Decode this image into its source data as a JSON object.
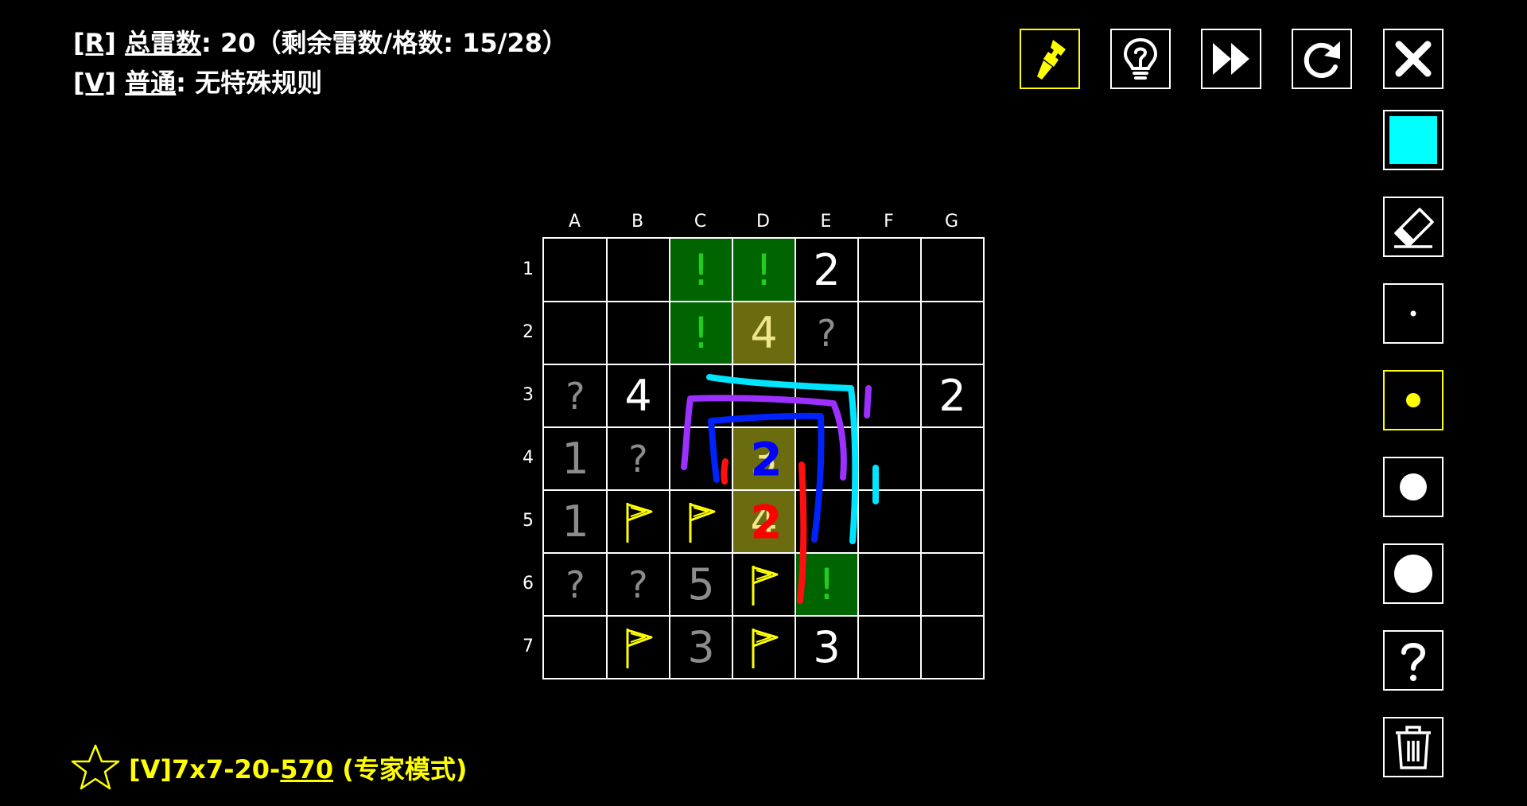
{
  "header": {
    "rule_r_key": "[R]",
    "rule_r_label": "总雷数",
    "rule_r_value": ": 20（剩余雷数/格数: 15/28）",
    "rule_v_key": "[V]",
    "rule_v_label": "普通",
    "rule_v_value": ": 无特殊规则"
  },
  "toolbar": [
    {
      "name": "brush-tool-button",
      "icon": "brush-icon",
      "active": true
    },
    {
      "name": "hint-button",
      "icon": "lightbulb-icon",
      "active": false
    },
    {
      "name": "fast-forward-button",
      "icon": "fast-forward-icon",
      "active": false
    },
    {
      "name": "restart-button",
      "icon": "refresh-icon",
      "active": false
    },
    {
      "name": "close-button",
      "icon": "close-icon",
      "active": false
    }
  ],
  "side_tools": [
    {
      "name": "color-cyan-button",
      "icon": "color-swatch-icon",
      "color": "#00ffff",
      "active": false
    },
    {
      "name": "eraser-button",
      "icon": "eraser-icon",
      "active": false
    },
    {
      "name": "brush-size-tiny-button",
      "icon": "dot-tiny-icon",
      "active": false
    },
    {
      "name": "brush-size-small-button",
      "icon": "dot-small-icon",
      "color": "#ffff00",
      "active": true
    },
    {
      "name": "brush-size-medium-button",
      "icon": "dot-medium-icon",
      "active": false
    },
    {
      "name": "brush-size-large-button",
      "icon": "dot-large-icon",
      "active": false
    },
    {
      "name": "help-button",
      "icon": "question-icon",
      "active": false
    },
    {
      "name": "clear-drawing-button",
      "icon": "trash-icon",
      "active": false
    }
  ],
  "board": {
    "columns": [
      "A",
      "B",
      "C",
      "D",
      "E",
      "F",
      "G"
    ],
    "rows": [
      "1",
      "2",
      "3",
      "4",
      "5",
      "6",
      "7"
    ],
    "cells": [
      [
        {
          "t": ""
        },
        {
          "t": ""
        },
        {
          "t": "!",
          "s": "mine"
        },
        {
          "t": "!",
          "s": "mine"
        },
        {
          "t": "2",
          "s": "num"
        },
        {
          "t": ""
        },
        {
          "t": ""
        }
      ],
      [
        {
          "t": ""
        },
        {
          "t": ""
        },
        {
          "t": "!",
          "s": "mine"
        },
        {
          "t": "4",
          "s": "hl"
        },
        {
          "t": "?",
          "s": "q"
        },
        {
          "t": ""
        },
        {
          "t": ""
        }
      ],
      [
        {
          "t": "?",
          "s": "q"
        },
        {
          "t": "4",
          "s": "num"
        },
        {
          "t": ""
        },
        {
          "t": ""
        },
        {
          "t": ""
        },
        {
          "t": ""
        },
        {
          "t": "2",
          "s": "num"
        }
      ],
      [
        {
          "t": "1",
          "s": "dim"
        },
        {
          "t": "?",
          "s": "q"
        },
        {
          "t": ""
        },
        {
          "t": "3",
          "s": "hl"
        },
        {
          "t": ""
        },
        {
          "t": ""
        },
        {
          "t": ""
        }
      ],
      [
        {
          "t": "1",
          "s": "dim"
        },
        {
          "t": "flag",
          "s": "flag"
        },
        {
          "t": "flag",
          "s": "flag"
        },
        {
          "t": "4",
          "s": "hl"
        },
        {
          "t": ""
        },
        {
          "t": ""
        },
        {
          "t": ""
        }
      ],
      [
        {
          "t": "?",
          "s": "q"
        },
        {
          "t": "?",
          "s": "q"
        },
        {
          "t": "5",
          "s": "dim"
        },
        {
          "t": "flag",
          "s": "flag"
        },
        {
          "t": "!",
          "s": "mine"
        },
        {
          "t": ""
        },
        {
          "t": ""
        }
      ],
      [
        {
          "t": ""
        },
        {
          "t": "flag",
          "s": "flag"
        },
        {
          "t": "3",
          "s": "dim"
        },
        {
          "t": "flag",
          "s": "flag"
        },
        {
          "t": "3",
          "s": "num"
        },
        {
          "t": ""
        },
        {
          "t": ""
        }
      ]
    ]
  },
  "annotations": [
    {
      "text": "2",
      "color": "#0000ff",
      "cell": "D4"
    },
    {
      "text": "2",
      "color": "#ff0000",
      "cell": "D5"
    }
  ],
  "colors": {
    "background": "#000000",
    "mine_cell": "#006400",
    "mine_mark": "#22cc22",
    "highlight_cell": "#6b6b0f",
    "highlight_text": "#f0e68c",
    "flag": "#ffff00",
    "dim_text": "#8c8c8c",
    "accent": "#ffff00"
  },
  "footer": {
    "star_icon": "star-outline-icon",
    "text_prefix": "[V]7x7-20-",
    "text_seed": "570",
    "text_suffix": " (专家模式)"
  }
}
